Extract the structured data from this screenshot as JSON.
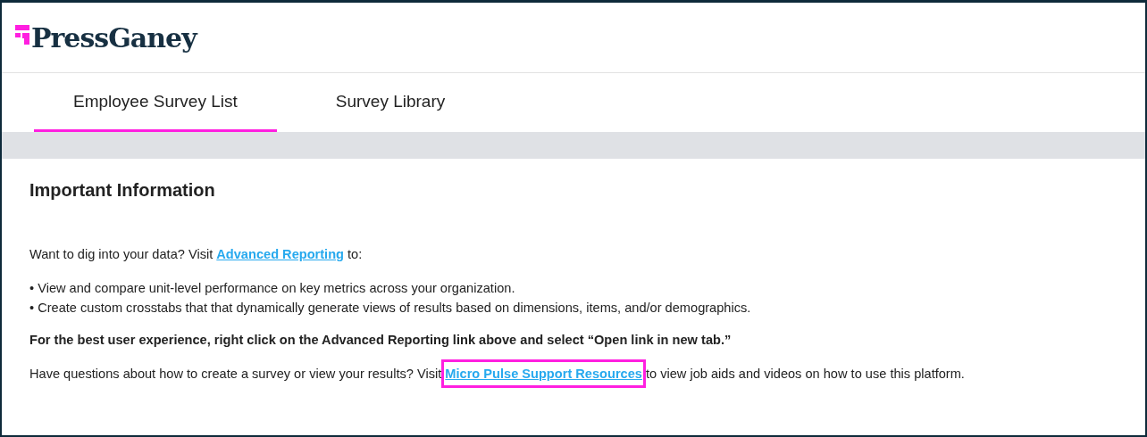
{
  "logo": {
    "text": "PressGaney"
  },
  "tabs": [
    {
      "label": "Employee Survey List",
      "selected": true
    },
    {
      "label": "Survey Library",
      "selected": false
    }
  ],
  "panel": {
    "title": "Important Information",
    "intro": {
      "before": "Want to dig into your data? Visit ",
      "link": "Advanced Reporting",
      "after": " to:",
      "highlighted": false
    },
    "bullets": [
      "• View and compare unit-level performance on key metrics across your organization.",
      "• Create custom crosstabs that that dynamically generate views of results based on dimensions, items, and/or demographics."
    ],
    "note": "For the best user experience, right click on the Advanced Reporting link above and select “Open link in new tab.”",
    "help": {
      "before": "Have questions about how to create a survey or view your results? Visit ",
      "link": "Micro Pulse Support Resources",
      "after": " to view job aids and videos on how to use this platform.",
      "highlighted": true
    }
  }
}
